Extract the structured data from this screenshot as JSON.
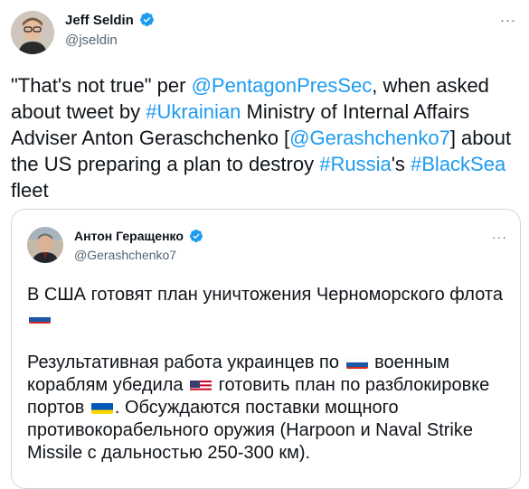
{
  "tweet": {
    "author_name": "Jeff Seldin",
    "author_handle": "@jseldin",
    "more_label": "···",
    "body": {
      "p1": "\"That's not true\"  per ",
      "mention1": "@PentagonPresSec",
      "p2": ", when asked about tweet by ",
      "hashtag1": "#Ukrainian",
      "p3": " Ministry of Internal Affairs Adviser Anton Geraschchenko [",
      "mention2": "@Gerashchenko7",
      "p4": "] about the US preparing a plan to destroy ",
      "hashtag2": "#Russia",
      "p5": "'s ",
      "hashtag3": "#BlackSea",
      "p6": " fleet"
    }
  },
  "quoted": {
    "author_name": "Антон Геращенко",
    "author_handle": "@Gerashchenko7",
    "more_label": "···",
    "line1a": "В США готовят план уничтожения Черноморского флота ",
    "para2a": "Результативная работа украинцев по ",
    "para2b": " военным кораблям убедила ",
    "para2c": " готовить план по разблокировке портов ",
    "para2d": ".  Обсуждаются поставки мощного противокорабельного оружия (Harpoon и Naval Strike Missile с дальностью 250-300 км)."
  },
  "colors": {
    "link": "#1d9bf0",
    "verified": "#1d9bf0",
    "border": "#cfd9de"
  },
  "icons": [
    "verified-badge-icon",
    "russia-flag-icon",
    "usa-flag-icon",
    "ukraine-flag-icon",
    "more-icon"
  ]
}
